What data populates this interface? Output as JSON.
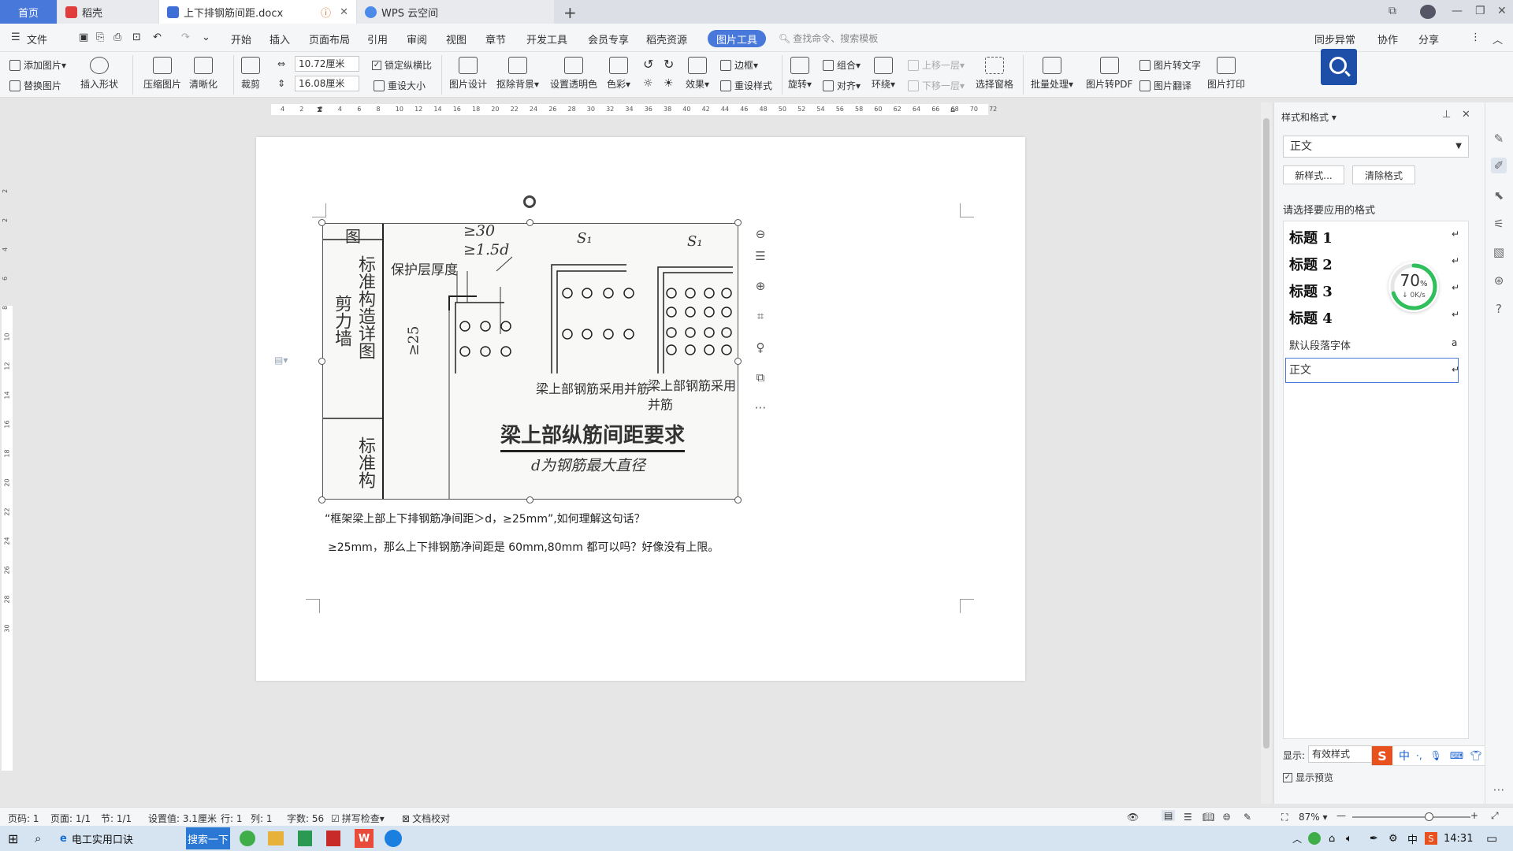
{
  "tabs": [
    {
      "label": "首页"
    },
    {
      "label": "稻壳"
    },
    {
      "label": "上下排钢筋间距.docx"
    },
    {
      "label": "WPS 云空间"
    }
  ],
  "menu": {
    "file": "文件",
    "items": [
      "开始",
      "插入",
      "页面布局",
      "引用",
      "审阅",
      "视图",
      "章节",
      "开发工具",
      "会员专享",
      "稻壳资源"
    ],
    "active_tab": "图片工具",
    "search_placeholder": "查找命令、搜索模板",
    "sync": "同步异常",
    "collab": "协作",
    "share": "分享"
  },
  "ribbon": {
    "add_picture": "添加图片",
    "replace_picture": "替换图片",
    "insert_shape": "插入形状",
    "compress": "压缩图片",
    "sharpen": "清晰化",
    "crop": "裁剪",
    "width": "10.72厘米",
    "height": "16.08厘米",
    "lock_ratio": "锁定纵横比",
    "reset_size": "重设大小",
    "pic_design": "图片设计",
    "remove_bg": "抠除背景",
    "set_transparent": "设置透明色",
    "color": "色彩",
    "effect": "效果",
    "border": "边框",
    "reset_style": "重设样式",
    "rotate": "旋转",
    "group": "组合",
    "align": "对齐",
    "bring_forward": "上移一层",
    "send_backward": "下移一层",
    "wrap": "环绕",
    "select_pane": "选择窗格",
    "batch": "批量处理",
    "to_pdf": "图片转PDF",
    "to_text": "图片转文字",
    "translate": "图片翻译",
    "print": "图片打印"
  },
  "ruler_ticks": [
    "4",
    "2",
    "2",
    "4",
    "6",
    "8",
    "10",
    "12",
    "14",
    "16",
    "18",
    "20",
    "22",
    "24",
    "26",
    "28",
    "30",
    "32",
    "34",
    "36",
    "38",
    "40",
    "42",
    "44",
    "46",
    "48",
    "50",
    "52",
    "54",
    "56",
    "58",
    "60",
    "62",
    "64",
    "66",
    "68",
    "70",
    "72"
  ],
  "vruler_ticks": [
    "2",
    "2",
    "4",
    "6",
    "8",
    "10",
    "12",
    "14",
    "16",
    "18",
    "20",
    "22",
    "24",
    "26",
    "28",
    "30"
  ],
  "figure": {
    "left_col_top": "图",
    "left_col_mid": "标准构造详图",
    "left_col_label": "剪力墙",
    "left_col_bottom": "标准构",
    "dim1": "≥30",
    "dim2": "≥1.5d",
    "cover": "保护层厚度",
    "dim3": "≥25",
    "s1": "S₁",
    "note1": "梁上部钢筋采用并筋",
    "note2": "梁上部钢筋采用并筋",
    "title": "梁上部纵筋间距要求",
    "subtitle": "d为钢筋最大直径"
  },
  "document": {
    "line1": "“框架梁上部上下排钢筋净间距＞d，≥25mm”,如何理解这句话？",
    "line2": "≥25mm，那么上下排钢筋净间距是 60mm,80mm 都可以吗？好像没有上限。"
  },
  "style_pane": {
    "title": "样式和格式",
    "current": "正文",
    "new_style": "新样式...",
    "clear_format": "清除格式",
    "prompt": "请选择要应用的格式",
    "styles": [
      "标题 1",
      "标题 2",
      "标题 3",
      "标题 4"
    ],
    "default_font": "默认段落字体",
    "normal": "正文",
    "show_label": "显示:",
    "show_value": "有效样式",
    "preview": "显示预览"
  },
  "progress": {
    "percent": "70",
    "unit": "%",
    "speed": "0K/s"
  },
  "status": {
    "page_num": "页码: 1",
    "pages": "页面: 1/1",
    "section": "节: 1/1",
    "setting": "设置值: 3.1厘米",
    "row": "行: 1",
    "col": "列: 1",
    "words": "字数: 56",
    "spell": "拼写检查",
    "proof": "文档校对",
    "zoom": "87%"
  },
  "taskbar": {
    "app1": "电工实用口诀",
    "search_btn": "搜索一下",
    "time": "14:31"
  },
  "colors": {
    "accent": "#4878d9",
    "search_bg": "#1e4fa8",
    "progress": "#2fbf5b"
  }
}
